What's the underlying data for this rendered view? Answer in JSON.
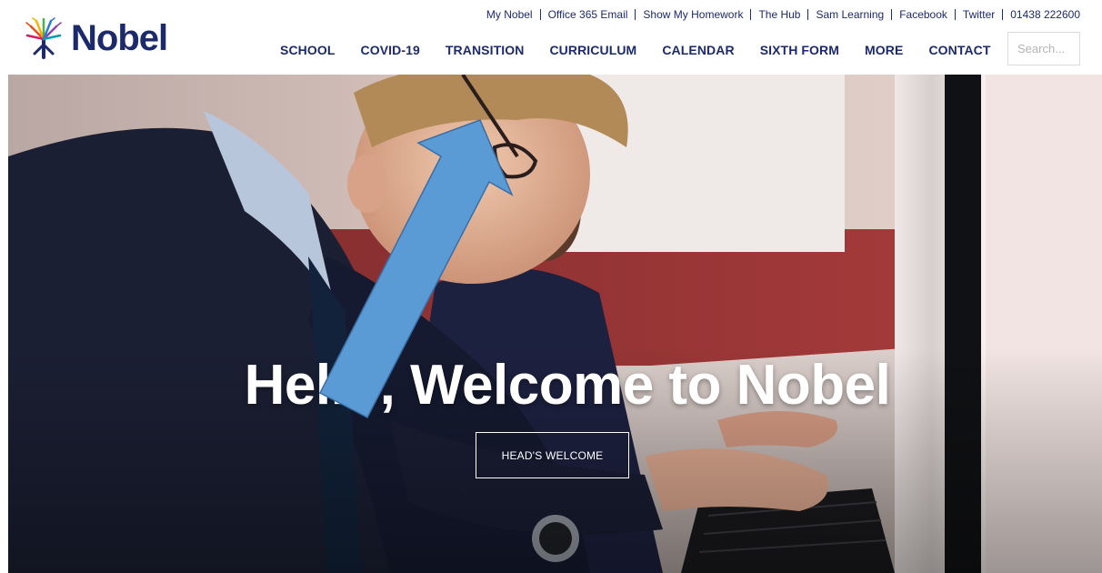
{
  "brand": {
    "name": "Nobel",
    "logo_icon": "tree-icon",
    "primary_color": "#1c2a6b"
  },
  "toplinks": [
    "My Nobel",
    "Office 365 Email",
    "Show My Homework",
    "The Hub",
    "Sam Learning",
    "Facebook",
    "Twitter",
    "01438 222600"
  ],
  "nav": [
    "SCHOOL",
    "COVID-19",
    "TRANSITION",
    "CURRICULUM",
    "CALENDAR",
    "SIXTH FORM",
    "MORE",
    "CONTACT"
  ],
  "search": {
    "placeholder": "Search...",
    "value": ""
  },
  "hero": {
    "title": "Hello, Welcome to Nobel",
    "button_label": "HEAD'S WELCOME",
    "annotation_color": "#5b9bd5"
  }
}
